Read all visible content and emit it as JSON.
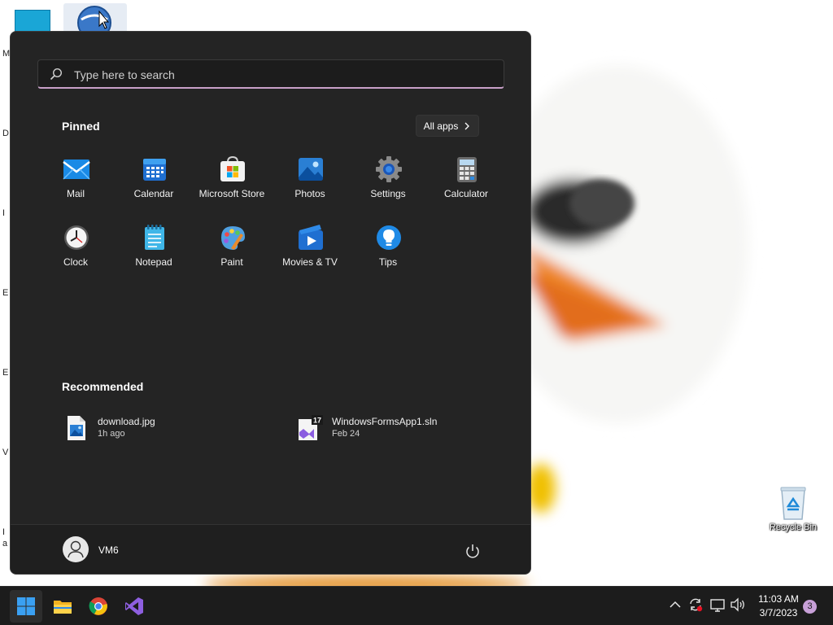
{
  "desktop": {
    "edge_letters": [
      "M",
      "D",
      "I",
      "E",
      "E",
      "V",
      "I",
      "a"
    ],
    "recycle_bin_label": "Recycle Bin"
  },
  "start_menu": {
    "search": {
      "placeholder": "Type here to search"
    },
    "pinned": {
      "title": "Pinned",
      "all_apps_label": "All apps",
      "apps": [
        {
          "name": "Mail",
          "icon": "mail-icon"
        },
        {
          "name": "Calendar",
          "icon": "calendar-icon"
        },
        {
          "name": "Microsoft Store",
          "icon": "store-icon"
        },
        {
          "name": "Photos",
          "icon": "photos-icon"
        },
        {
          "name": "Settings",
          "icon": "gear-icon"
        },
        {
          "name": "Calculator",
          "icon": "calculator-icon"
        },
        {
          "name": "Clock",
          "icon": "clock-icon"
        },
        {
          "name": "Notepad",
          "icon": "notepad-icon"
        },
        {
          "name": "Paint",
          "icon": "paint-icon"
        },
        {
          "name": "Movies & TV",
          "icon": "movies-icon"
        },
        {
          "name": "Tips",
          "icon": "lightbulb-icon"
        }
      ]
    },
    "recommended": {
      "title": "Recommended",
      "items": [
        {
          "name": "download.jpg",
          "time": "1h ago",
          "icon": "image-file-icon"
        },
        {
          "name": "WindowsFormsApp1.sln",
          "time": "Feb 24",
          "icon": "visual-studio-solution-icon",
          "badge": "17"
        }
      ]
    },
    "user": {
      "name": "VM6"
    }
  },
  "taskbar": {
    "apps": [
      "start-icon",
      "file-explorer-icon",
      "chrome-icon",
      "visual-studio-icon"
    ],
    "clock": {
      "time": "11:03 AM",
      "date": "3/7/2023"
    },
    "notification_count": "3"
  },
  "colors": {
    "menu_background": "#242424",
    "taskbar_background": "#1c1c1c",
    "accent": "#0078d4",
    "search_underline": "#c8a0c8"
  }
}
